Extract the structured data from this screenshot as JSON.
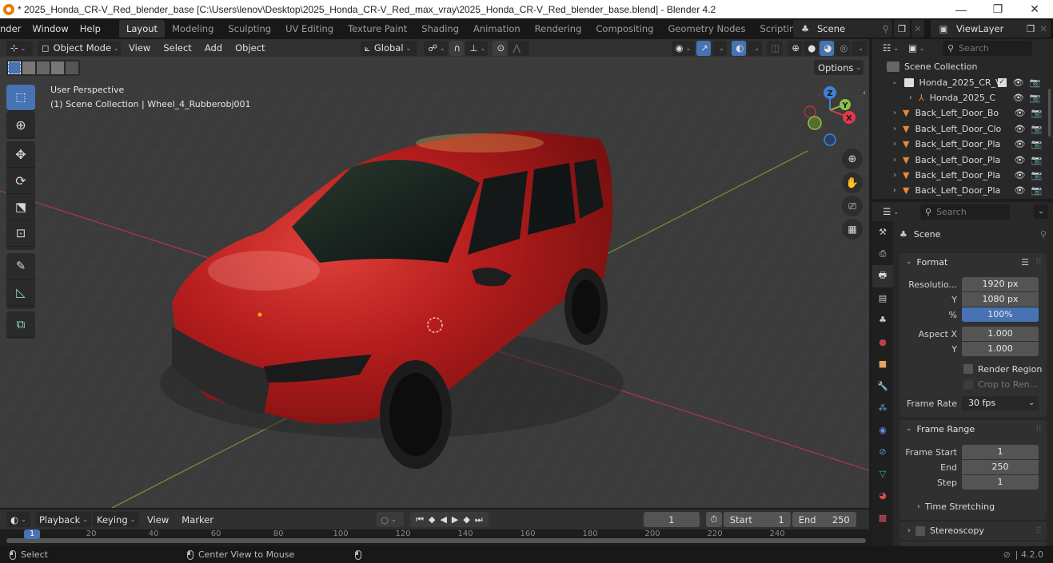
{
  "window": {
    "title": "* 2025_Honda_CR-V_Red_blender_base [C:\\Users\\lenov\\Desktop\\2025_Honda_CR-V_Red_max_vray\\2025_Honda_CR-V_Red_blender_base.blend] - Blender 4.2",
    "minimize": "—",
    "maximize": "❐",
    "close": "✕"
  },
  "topbar": {
    "menus": [
      "nder",
      "Window",
      "Help"
    ],
    "workspaces": [
      "Layout",
      "Modeling",
      "Sculpting",
      "UV Editing",
      "Texture Paint",
      "Shading",
      "Animation",
      "Rendering",
      "Compositing",
      "Geometry Nodes",
      "Scripting"
    ],
    "active_workspace": "Layout",
    "add_tab": "+",
    "scene": "Scene",
    "view_layer": "ViewLayer"
  },
  "viewport": {
    "mode": "Object Mode",
    "menus": [
      "View",
      "Select",
      "Add",
      "Object"
    ],
    "transform_orientation": "Global",
    "options_label": "Options",
    "perspective_label": "User Perspective",
    "collection_label": "(1) Scene Collection | Wheel_4_Rubberobj001",
    "gizmo_axes": {
      "x": "X",
      "y": "Y",
      "z": "Z"
    },
    "colors": {
      "x_axis": "#e2384a",
      "y_axis": "#8bc34a",
      "z_axis": "#3d82d6",
      "active": "#4772b3"
    }
  },
  "outliner": {
    "search_placeholder": "Search",
    "root": "Scene Collection",
    "items": [
      {
        "label": "Honda_2025_CR_V",
        "type": "collection",
        "level": 1,
        "checked": true
      },
      {
        "label": "Honda_2025_C",
        "type": "empty",
        "level": 2
      },
      {
        "label": "Back_Left_Door_Bo",
        "type": "mesh",
        "level": 1
      },
      {
        "label": "Back_Left_Door_Clo",
        "type": "mesh",
        "level": 1
      },
      {
        "label": "Back_Left_Door_Pla",
        "type": "mesh",
        "level": 1
      },
      {
        "label": "Back_Left_Door_Pla",
        "type": "mesh",
        "level": 1
      },
      {
        "label": "Back_Left_Door_Pla",
        "type": "mesh",
        "level": 1
      },
      {
        "label": "Back_Left_Door_Pla",
        "type": "mesh",
        "level": 1
      }
    ]
  },
  "properties": {
    "search_placeholder": "Search",
    "context": "Scene",
    "format": {
      "title": "Format",
      "resolution_x_label": "Resolutio...",
      "resolution_x": "1920 px",
      "resolution_y_label": "Y",
      "resolution_y": "1080 px",
      "percent_label": "%",
      "percent": "100%",
      "aspect_x_label": "Aspect X",
      "aspect_x": "1.000",
      "aspect_y_label": "Y",
      "aspect_y": "1.000",
      "render_region": "Render Region",
      "crop": "Crop to Ren...",
      "frame_rate_label": "Frame Rate",
      "frame_rate": "30 fps"
    },
    "frame_range": {
      "title": "Frame Range",
      "start_label": "Frame Start",
      "start": "1",
      "end_label": "End",
      "end": "250",
      "step_label": "Step",
      "step": "1",
      "time_stretching": "Time Stretching"
    },
    "stereoscopy": "Stereoscopy",
    "tabs": [
      "tool",
      "render",
      "output",
      "view-layer",
      "scene",
      "world",
      "object",
      "modifiers",
      "particles",
      "physics",
      "constraints",
      "data",
      "material",
      "texture"
    ]
  },
  "timeline": {
    "menus": [
      "Playback",
      "Keying",
      "View",
      "Marker"
    ],
    "current_frame": "1",
    "start_label": "Start",
    "start": "1",
    "end_label": "End",
    "end": "250",
    "ticks": [
      "1",
      "20",
      "40",
      "60",
      "80",
      "100",
      "120",
      "140",
      "160",
      "180",
      "200",
      "220",
      "240"
    ]
  },
  "statusbar": {
    "select": "Select",
    "center_view": "Center View to Mouse",
    "version": "4.2.0"
  }
}
